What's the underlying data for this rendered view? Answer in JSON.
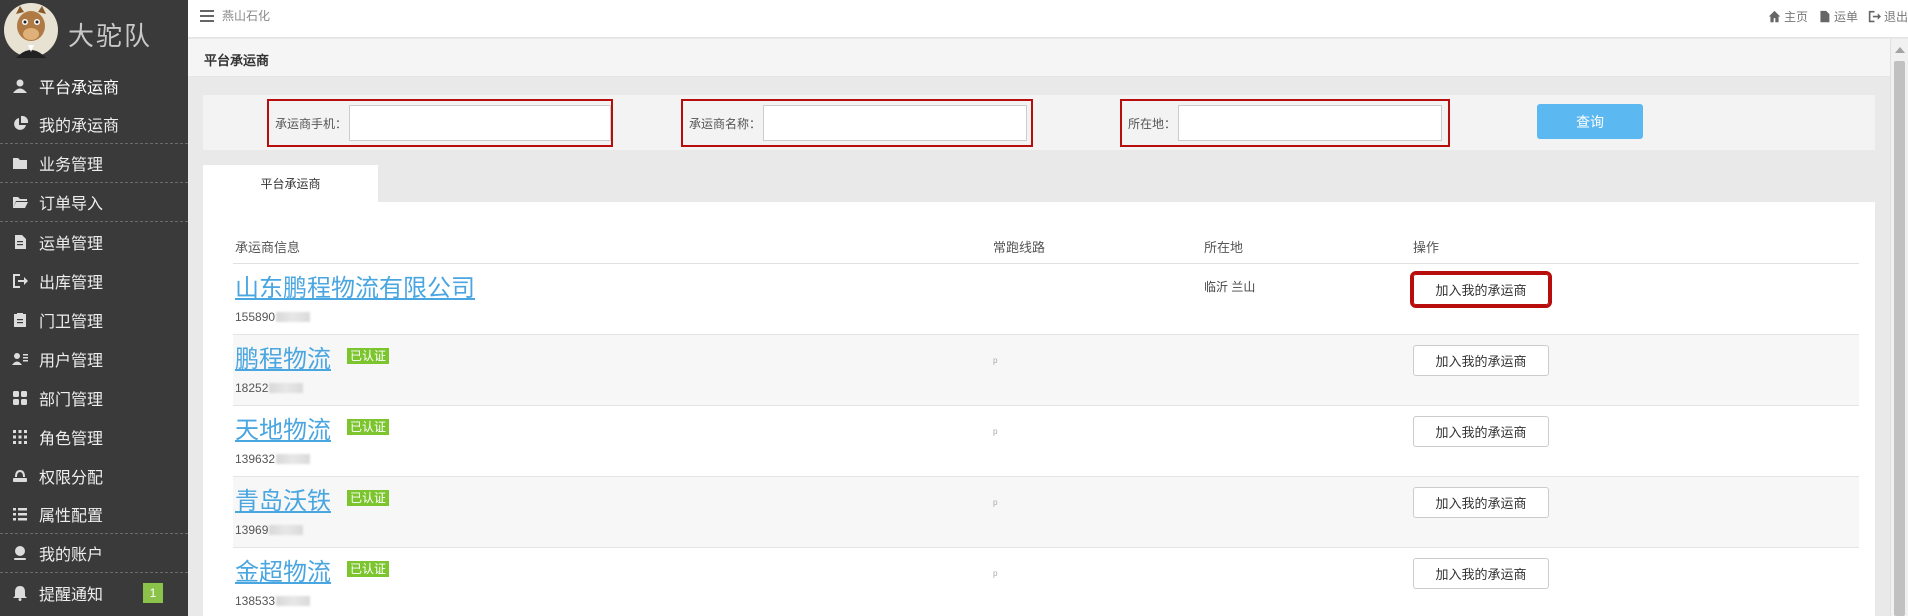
{
  "brand": {
    "name": "大驼队"
  },
  "sidebar": {
    "items": [
      {
        "label": "平台承运商",
        "icon": "user-icon",
        "active": true
      },
      {
        "label": "我的承运商",
        "icon": "pie-chart-icon"
      },
      {
        "label": "业务管理",
        "icon": "folder-icon"
      },
      {
        "label": "订单导入",
        "icon": "folder-open-icon"
      },
      {
        "label": "运单管理",
        "icon": "file-icon"
      },
      {
        "label": "出库管理",
        "icon": "export-icon"
      },
      {
        "label": "门卫管理",
        "icon": "clipboard-icon"
      },
      {
        "label": "用户管理",
        "icon": "users-icon"
      },
      {
        "label": "部门管理",
        "icon": "grid-icon"
      },
      {
        "label": "角色管理",
        "icon": "dots-grid-icon"
      },
      {
        "label": "权限分配",
        "icon": "key-icon"
      },
      {
        "label": "属性配置",
        "icon": "list-icon"
      },
      {
        "label": "我的账户",
        "icon": "account-icon"
      },
      {
        "label": "提醒通知",
        "icon": "bell-icon",
        "badge": "1"
      }
    ]
  },
  "topbar": {
    "company": "燕山石化",
    "links": [
      {
        "label": "主页",
        "icon": "home-icon"
      },
      {
        "label": "运单",
        "icon": "document-icon"
      },
      {
        "label": "退出",
        "icon": "logout-icon"
      }
    ]
  },
  "page": {
    "title": "平台承运商"
  },
  "search": {
    "phone_label": "承运商手机：",
    "name_label": "承运商名称：",
    "location_label": "所在地：",
    "button": "查询"
  },
  "tabs": [
    {
      "label": "平台承运商"
    }
  ],
  "table": {
    "headers": {
      "info": "承运商信息",
      "routes": "常跑线路",
      "location": "所在地",
      "actions": "操作"
    },
    "rows": [
      {
        "name": "山东鹏程物流有限公司",
        "phone": "155890",
        "location": "临沂 兰山",
        "route": "",
        "verified": "",
        "action": "加入我的承运商"
      },
      {
        "name": "鹏程物流",
        "phone": "18252",
        "location": "",
        "route": "ᵖ",
        "verified": "已认证",
        "action": "加入我的承运商"
      },
      {
        "name": "天地物流",
        "phone": "139632",
        "location": "",
        "route": "ᵖ",
        "verified": "已认证",
        "action": "加入我的承运商"
      },
      {
        "name": "青岛沃铁",
        "phone": "13969",
        "location": "",
        "route": "ᵖ",
        "verified": "已认证",
        "action": "加入我的承运商"
      },
      {
        "name": "金超物流",
        "phone": "138533",
        "location": "",
        "route": "ᵖ",
        "verified": "已认证",
        "action": "加入我的承运商"
      }
    ]
  }
}
